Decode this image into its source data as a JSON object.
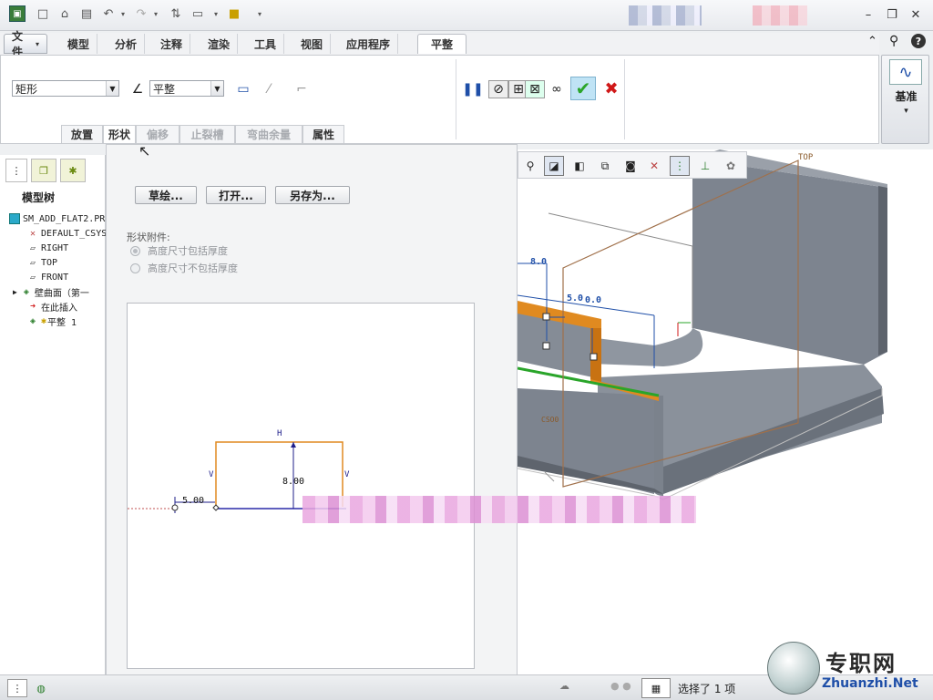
{
  "menu": {
    "file_label": "文件",
    "tabs": [
      "模型",
      "分析",
      "注释",
      "渲染",
      "工具",
      "视图",
      "应用程序"
    ],
    "active_tab": "平整"
  },
  "ribbon": {
    "shape_select": "矩形",
    "type_select": "平整",
    "subtabs": [
      "放置",
      "形状",
      "偏移",
      "止裂槽",
      "弯曲余量",
      "属性"
    ],
    "datum_label": "基准"
  },
  "tree": {
    "header": "模型树",
    "items": [
      "SM_ADD_FLAT2.PR",
      "DEFAULT_CSYS",
      "RIGHT",
      "TOP",
      "FRONT",
      "壁曲面（第一",
      "在此插入",
      "平整 1"
    ]
  },
  "shape_panel": {
    "sketch_button": "草绘...",
    "open_button": "打开...",
    "save_as_button": "另存为...",
    "attach_label": "形状附件:",
    "option_include": "高度尺寸包括厚度",
    "option_exclude": "高度尺寸不包括厚度",
    "sketch_dims": {
      "top": "H",
      "left": "V",
      "right": "V",
      "height": "8.00",
      "offset": "5.00"
    }
  },
  "viewport": {
    "dim_height": "8.0",
    "dim_offset": "5.0",
    "dim_offset2": "0.0",
    "plane_top": "TOP",
    "csys": "CSO0"
  },
  "status": {
    "selection": "选择了 1 项",
    "watermark_cn": "专职网",
    "watermark_url": "Zhuanzhi.Net"
  },
  "colors": {
    "accent_blue": "#1f4fa8",
    "confirm_green": "#2aa52a",
    "cancel_red": "#d01818",
    "wall_orange": "#e08a20",
    "model_gray": "#7d848f"
  }
}
